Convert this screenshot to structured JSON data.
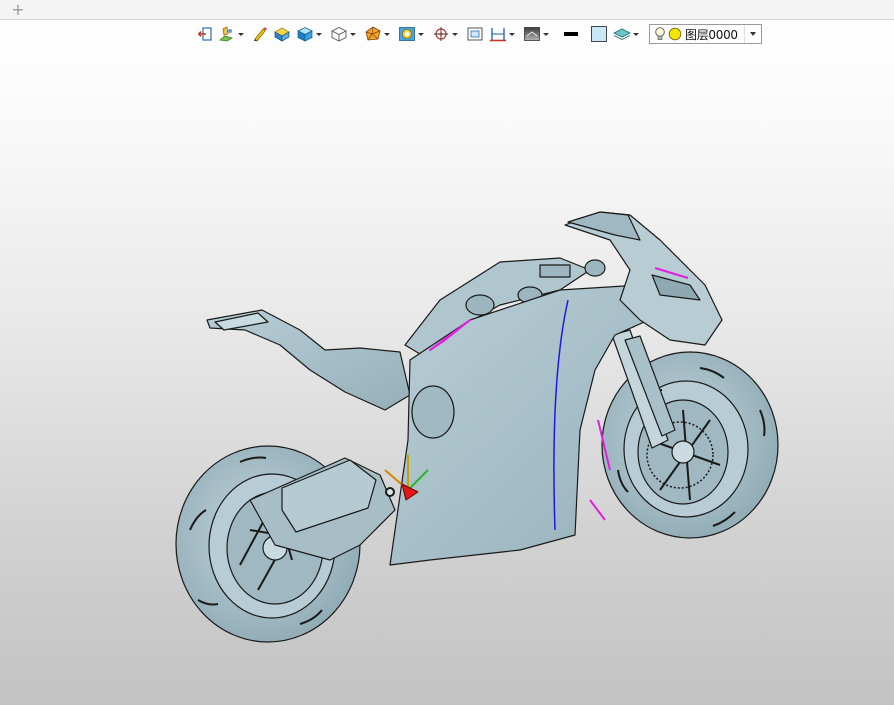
{
  "tabbar": {
    "add_icon": "plus-icon",
    "add_glyph": "+"
  },
  "toolbar": {
    "buttons": [
      {
        "name": "exit-sketch-button",
        "icon": "exit-icon",
        "dropdown": false
      },
      {
        "name": "sketch-tools-button",
        "icon": "sketch-icon",
        "dropdown": true
      },
      {
        "name": "edit-tool-button",
        "icon": "pencil-icon",
        "dropdown": false
      },
      {
        "name": "solid-shape-button",
        "icon": "box-shape-icon",
        "dropdown": false
      },
      {
        "name": "display-mode-button",
        "icon": "shaded-cube-icon",
        "dropdown": true
      },
      {
        "name": "view-orientation-button",
        "icon": "wire-cube-icon",
        "dropdown": true
      },
      {
        "name": "render-style-button",
        "icon": "polyhedron-icon",
        "dropdown": true
      },
      {
        "name": "appearance-button",
        "icon": "appearance-icon",
        "dropdown": true
      },
      {
        "name": "snap-point-button",
        "icon": "target-icon",
        "dropdown": true
      },
      {
        "name": "frame-view-button",
        "icon": "frame-icon",
        "dropdown": false
      },
      {
        "name": "dimension-button",
        "icon": "dimension-icon",
        "dropdown": true
      },
      {
        "name": "background-button",
        "icon": "background-icon",
        "dropdown": true
      },
      {
        "name": "line-color-button",
        "icon": "line-color-icon",
        "dropdown": false
      },
      {
        "name": "face-color-button",
        "icon": "face-color-icon",
        "dropdown": false
      },
      {
        "name": "layer-manager-button",
        "icon": "layers-icon",
        "dropdown": true
      }
    ],
    "layer_select": {
      "value": "图层0000",
      "visibility_icon": "lightbulb-icon",
      "color_icon": "yellow-circle-icon"
    }
  },
  "viewport": {
    "model": "motorcycle-3d-model",
    "model_color": "#a7c0c9",
    "outline_color": "#1a1a1a",
    "highlight_edge_color": "#e020e0",
    "selected_edge_color": "#1a1ae0",
    "triad_icon": "coordinate-triad-icon"
  }
}
